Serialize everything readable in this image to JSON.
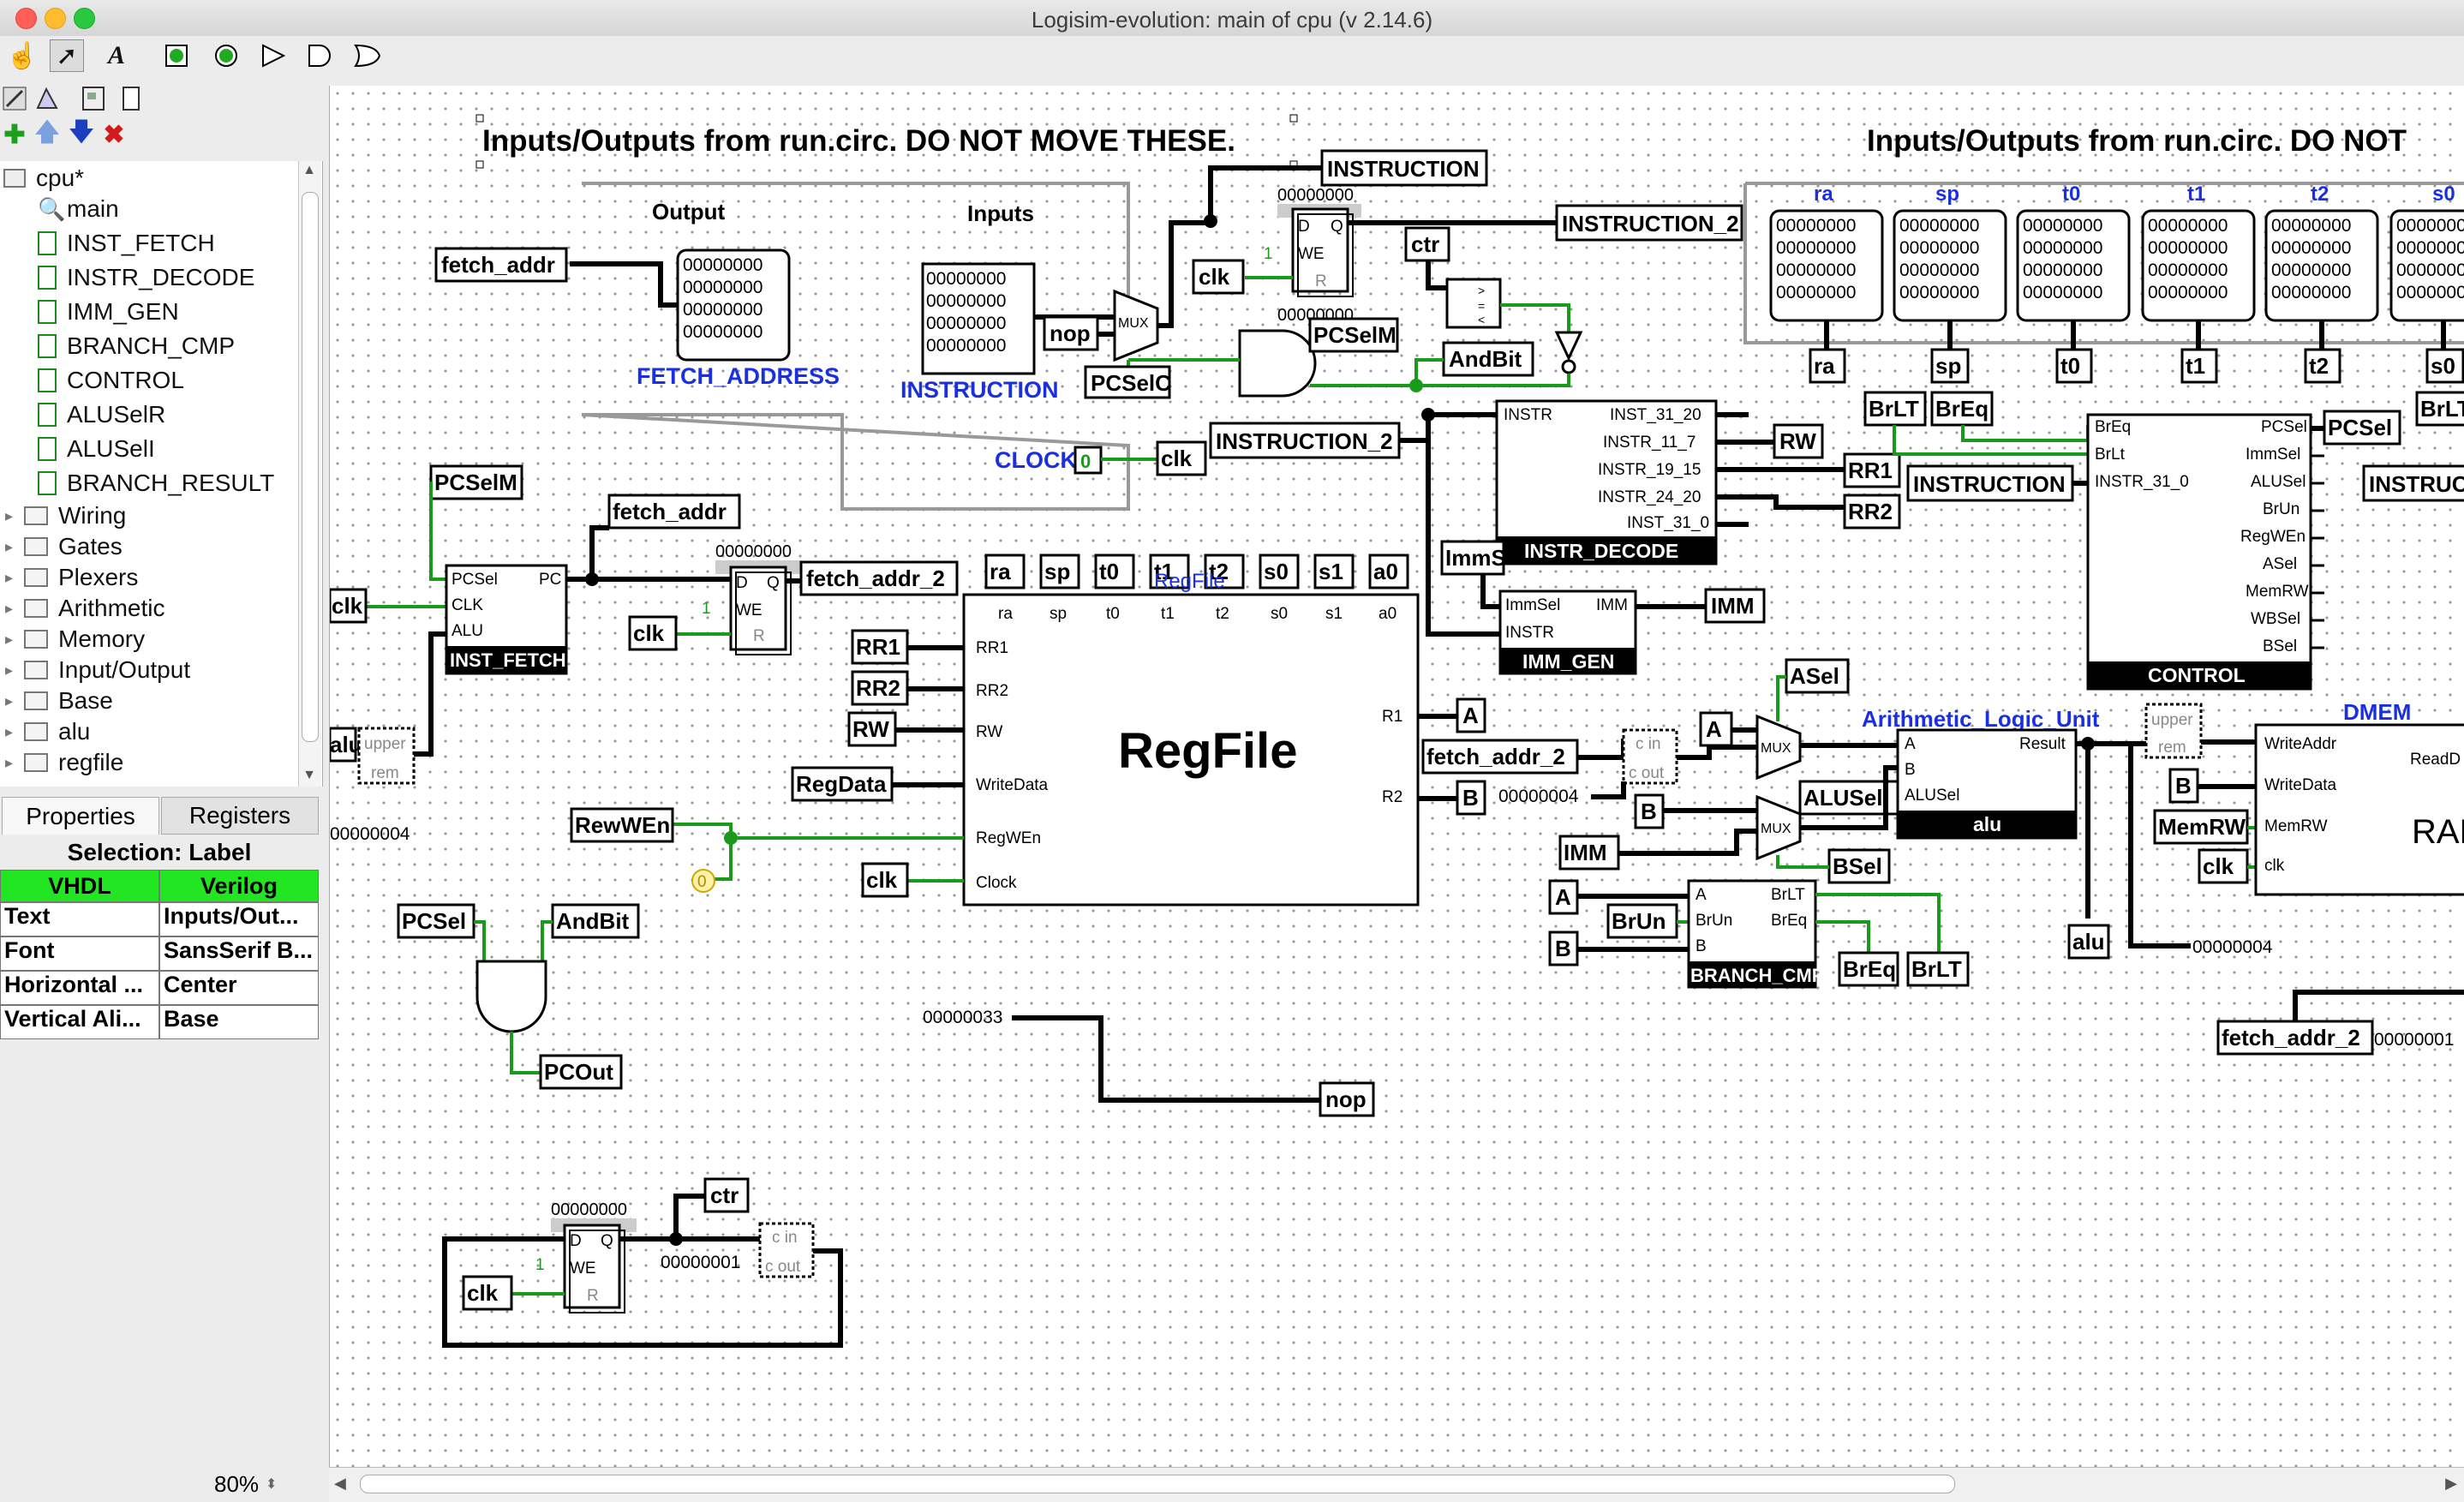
{
  "window": {
    "title": "Logisim-evolution: main of cpu (v 2.14.6)"
  },
  "tree": {
    "root": "cpu*",
    "items": [
      "main",
      "INST_FETCH",
      "INSTR_DECODE",
      "IMM_GEN",
      "BRANCH_CMP",
      "CONTROL",
      "ALUSelR",
      "ALUSelI",
      "BRANCH_RESULT"
    ],
    "folders": [
      "Wiring",
      "Gates",
      "Plexers",
      "Arithmetic",
      "Memory",
      "Input/Output",
      "Base",
      "alu",
      "regfile"
    ]
  },
  "tabs": {
    "properties": "Properties",
    "registers": "Registers"
  },
  "props": {
    "selection": "Selection: Label",
    "vhdl": "VHDL",
    "verilog": "Verilog",
    "rows": [
      {
        "k": "Text",
        "v": "Inputs/Out..."
      },
      {
        "k": "Font",
        "v": "SansSerif B..."
      },
      {
        "k": "Horizontal ...",
        "v": "Center"
      },
      {
        "k": "Vertical Ali...",
        "v": "Base"
      }
    ]
  },
  "zoom": "80%",
  "circuit": {
    "header_left": "Inputs/Outputs from run.circ. DO NOT MOVE THESE.",
    "header_right": "Inputs/Outputs from run.circ. DO NOT",
    "output_label": "Output",
    "inputs_label": "Inputs",
    "fetch_address": "FETCH_ADDRESS",
    "instruction": "INSTRUCTION",
    "clock": "CLOCK",
    "regfile_title": "RegFile",
    "regfile_name": "RegFile",
    "alu_title": "Arithmetic_Logic_Unit",
    "dmem": "DMEM",
    "ram": "RAM",
    "reg_names": [
      "ra",
      "sp",
      "t0",
      "t1",
      "t2",
      "s0",
      "s1",
      "a0"
    ],
    "hex_zero": "00000000",
    "hex_four": "00000004",
    "hex_one": "00000001",
    "hex_33": "00000033",
    "mux": "MUX",
    "tunnels": {
      "fetch_addr": "fetch_addr",
      "fetch_addr_2": "fetch_addr_2",
      "instruction": "INSTRUCTION",
      "instruction_2": "INSTRUCTION_2",
      "clk": "clk",
      "ctr": "ctr",
      "nop": "nop",
      "pcselm": "PCSelM",
      "pcselc": "PCSelC",
      "andbit": "AndBit",
      "pcsel": "PCSel",
      "pcout": "PCOut",
      "rr1": "RR1",
      "rr2": "RR2",
      "rw": "RW",
      "regdata": "RegData",
      "rewwen": "RewWEn",
      "a": "A",
      "b": "B",
      "imm": "IMM",
      "immsel": "ImmS",
      "asel": "ASel",
      "alusel": "ALUSel",
      "bsel": "BSel",
      "brun": "BrUn",
      "breq": "BrEq",
      "brlt": "BrLT",
      "alu": "alu",
      "memrw": "MemRW",
      "clk_tunnel": "clk"
    },
    "inst_fetch": {
      "name": "INST_FETCH",
      "pins": [
        "PCSel",
        "CLK",
        "ALU",
        "PC"
      ]
    },
    "instr_decode": {
      "name": "INSTR_DECODE",
      "in": "INSTR",
      "outs": [
        "INST_31_20",
        "INSTR_11_7",
        "INSTR_19_15",
        "INSTR_24_20",
        "INST_31_0"
      ]
    },
    "imm_gen": {
      "name": "IMM_GEN",
      "pins": [
        "ImmSel",
        "INSTR",
        "IMM"
      ]
    },
    "control": {
      "name": "CONTROL",
      "ins": [
        "BrEq",
        "BrLt",
        "INSTR_31_0"
      ],
      "outs": [
        "PCSel",
        "ImmSel",
        "ALUSel",
        "BrUn",
        "RegWEn",
        "ASel",
        "MemRW",
        "WBSel",
        "BSel"
      ]
    },
    "alu_block": {
      "name": "alu",
      "pins": [
        "A",
        "B",
        "ALUSel",
        "Result"
      ]
    },
    "branch_cmp": {
      "name": "BRANCH_CMP",
      "pins": [
        "A",
        "BrUn",
        "B",
        "BrLT",
        "BrEq"
      ]
    },
    "regfile_pins": {
      "left": [
        "RR1",
        "RR2",
        "RW",
        "WriteData",
        "RegWEn",
        "Clock"
      ],
      "right": [
        "R1",
        "R2"
      ]
    },
    "dmem_pins": [
      "WriteAddr",
      "WriteData",
      "MemRW",
      "clk",
      "ReadD"
    ],
    "register_pins": [
      "D",
      "Q",
      "WE",
      "R"
    ],
    "adder_pins": [
      "c in",
      "c out"
    ],
    "divider_pins": [
      "upper",
      "rem"
    ],
    "const_zero": "0",
    "const_one": "1"
  }
}
